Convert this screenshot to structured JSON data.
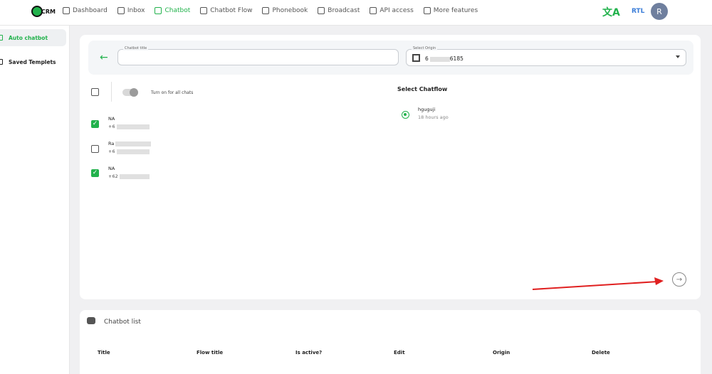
{
  "nav": {
    "logo_text": "CRM",
    "items": [
      {
        "label": "Dashboard",
        "icon": "dashboard-icon",
        "active": false
      },
      {
        "label": "Inbox",
        "icon": "inbox-icon",
        "active": false
      },
      {
        "label": "Chatbot",
        "icon": "robot-icon",
        "active": true
      },
      {
        "label": "Chatbot Flow",
        "icon": "flow-icon",
        "active": false
      },
      {
        "label": "Phonebook",
        "icon": "phonebook-icon",
        "active": false
      },
      {
        "label": "Broadcast",
        "icon": "broadcast-icon",
        "active": false
      },
      {
        "label": "API access",
        "icon": "api-icon",
        "active": false
      },
      {
        "label": "More features",
        "icon": "more-icon",
        "active": false
      }
    ],
    "translate_icon": "translate-icon",
    "rtl_label": "RTL",
    "avatar_letter": "R"
  },
  "sidebar": {
    "items": [
      {
        "label": "Auto chatbot",
        "active": true
      },
      {
        "label": "Saved Templets",
        "active": false
      }
    ]
  },
  "form": {
    "title_label": "Chatbot title",
    "title_value": "",
    "origin_label": "Select Origin",
    "origin_value_prefix": "6",
    "origin_value_suffix": "6185"
  },
  "toggle": {
    "label": "Turn on for all chats",
    "on": false
  },
  "contacts": [
    {
      "name": "NA",
      "phone_prefix": "+6",
      "checked": true
    },
    {
      "name": "Ra",
      "phone_prefix": "+6",
      "checked": false
    },
    {
      "name": "NA",
      "phone_prefix": "+62",
      "checked": true
    }
  ],
  "chatflow": {
    "title": "Select Chatflow",
    "items": [
      {
        "name": "hguguji",
        "time": "18 hours ago",
        "selected": true
      }
    ]
  },
  "chatbot_list": {
    "title": "Chatbot list",
    "columns": [
      "Title",
      "Flow title",
      "Is active?",
      "Edit",
      "Origin",
      "Delete"
    ]
  },
  "colors": {
    "accent": "#22b24c",
    "annotation": "#e02020"
  }
}
